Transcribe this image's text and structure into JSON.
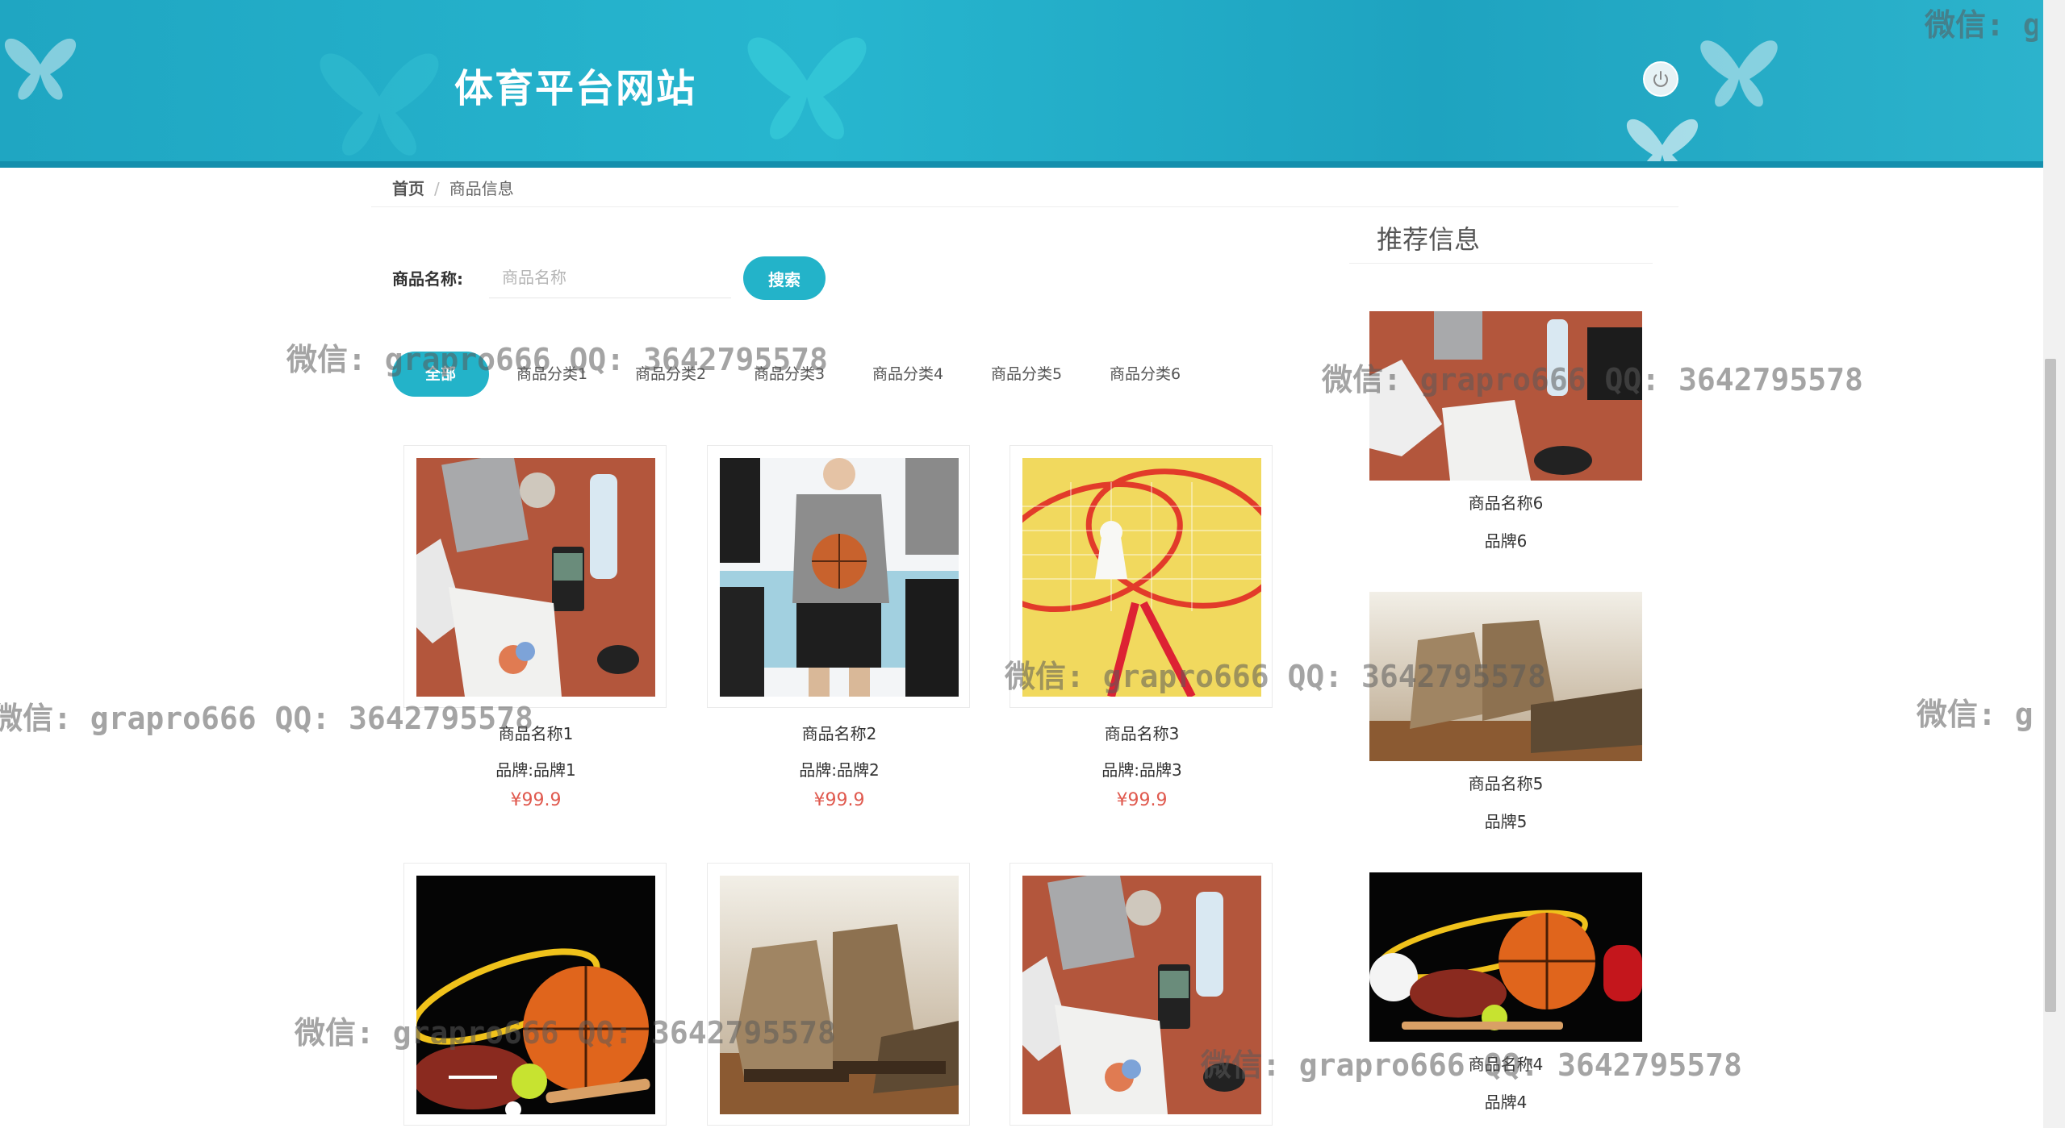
{
  "header": {
    "title": "体育平台网站"
  },
  "breadcrumb": {
    "home": "首页",
    "separator": "/",
    "current": "商品信息"
  },
  "search": {
    "label": "商品名称:",
    "placeholder": "商品名称",
    "value": "",
    "button": "搜索"
  },
  "categories": [
    "全部",
    "商品分类1",
    "商品分类2",
    "商品分类3",
    "商品分类4",
    "商品分类5",
    "商品分类6"
  ],
  "products": [
    {
      "name": "商品名称1",
      "brand": "品牌:品牌1",
      "price": "¥99.9",
      "image": "flatlay-image"
    },
    {
      "name": "商品名称2",
      "brand": "品牌:品牌2",
      "price": "¥99.9",
      "image": "apparel-image"
    },
    {
      "name": "商品名称3",
      "brand": "品牌:品牌3",
      "price": "¥99.9",
      "image": "badminton-image"
    },
    {
      "name": "",
      "brand": "",
      "price": "",
      "image": "sports-balls-image"
    },
    {
      "name": "",
      "brand": "",
      "price": "",
      "image": "hiking-boots-image"
    },
    {
      "name": "",
      "brand": "",
      "price": "",
      "image": "flatlay-image"
    }
  ],
  "recommend": {
    "title": "推荐信息",
    "items": [
      {
        "name": "商品名称6",
        "brand": "品牌6",
        "image": "flatlay-image"
      },
      {
        "name": "商品名称5",
        "brand": "品牌5",
        "image": "hiking-boots-image"
      },
      {
        "name": "商品名称4",
        "brand": "品牌4",
        "image": "sports-balls-image"
      }
    ]
  },
  "watermark": "微信: grapro666 QQ: 3642795578",
  "colors": {
    "accent": "#23b3c9",
    "header": "#1fa6c2",
    "price": "#e05a4f"
  }
}
